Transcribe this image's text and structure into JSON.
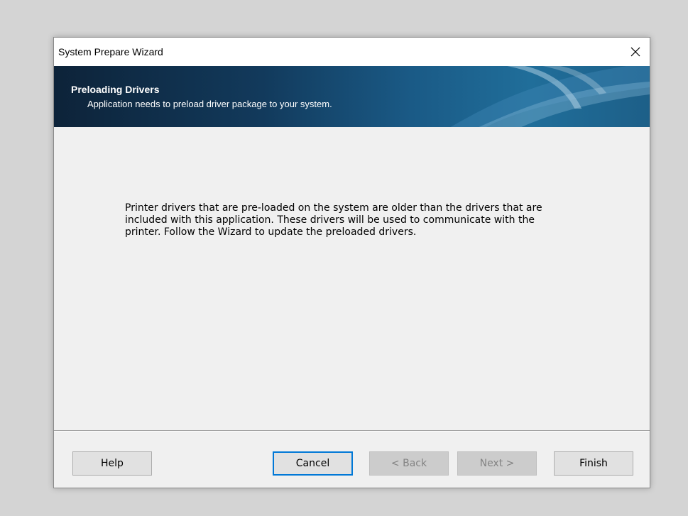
{
  "window": {
    "title": "System Prepare Wizard",
    "close_icon": "close-icon"
  },
  "banner": {
    "title": "Preloading Drivers",
    "subtitle": "Application needs to preload driver package to your system."
  },
  "content": {
    "message": "Printer drivers that are pre-loaded on the system are older than the drivers that are included with this application. These drivers will be used to communicate with the printer. Follow the Wizard to update the preloaded drivers."
  },
  "buttons": {
    "help": "Help",
    "cancel": "Cancel",
    "back": "< Back",
    "next": "Next >",
    "finish": "Finish"
  },
  "colors": {
    "banner_dark": "#0d2339",
    "banner_light": "#206e9a",
    "default_button_border": "#0078d7",
    "dialog_background": "#f0f0f0"
  }
}
